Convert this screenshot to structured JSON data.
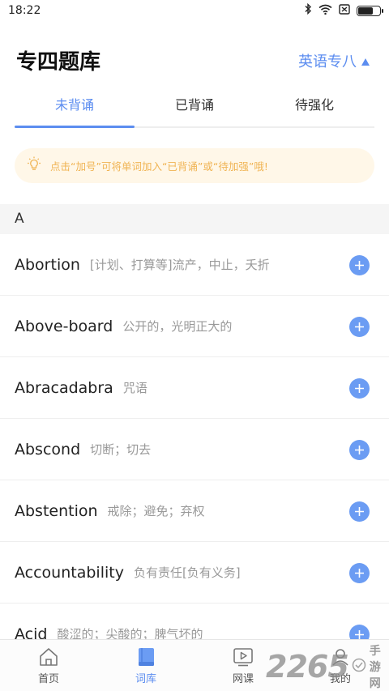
{
  "status_bar": {
    "time": "18:22"
  },
  "header": {
    "title": "专四题库",
    "level_select": "英语专八"
  },
  "tabs": [
    {
      "label": "未背诵",
      "active": true
    },
    {
      "label": "已背诵",
      "active": false
    },
    {
      "label": "待强化",
      "active": false
    }
  ],
  "tip": {
    "text": "点击“加号”可将单词加入“已背诵”或“待加强”哦!"
  },
  "section": {
    "letter": "A"
  },
  "words": [
    {
      "word": "Abortion",
      "meaning": "[计划、打算等]流产，中止，夭折"
    },
    {
      "word": "Above-board",
      "meaning": "公开的，光明正大的"
    },
    {
      "word": "Abracadabra",
      "meaning": "咒语"
    },
    {
      "word": "Abscond",
      "meaning": "切断；切去"
    },
    {
      "word": "Abstention",
      "meaning": "戒除；避免；弃权"
    },
    {
      "word": "Accountability",
      "meaning": "负有责任[负有义务]"
    },
    {
      "word": "Acid",
      "meaning": "酸涩的；尖酸的；脾气坏的"
    }
  ],
  "bottom_nav": [
    {
      "label": "首页",
      "icon": "home-icon",
      "active": false
    },
    {
      "label": "词库",
      "icon": "book-icon",
      "active": true
    },
    {
      "label": "网课",
      "icon": "video-play-icon",
      "active": false
    },
    {
      "label": "我的",
      "icon": "profile-icon",
      "active": false
    }
  ],
  "watermark": {
    "number": "2265",
    "text": "手游网"
  },
  "colors": {
    "accent": "#5c8df0",
    "tip_bg": "#fff7e8",
    "tip_text": "#f0b454",
    "add_button": "#6b9cf3"
  },
  "battery_level": 0.7
}
